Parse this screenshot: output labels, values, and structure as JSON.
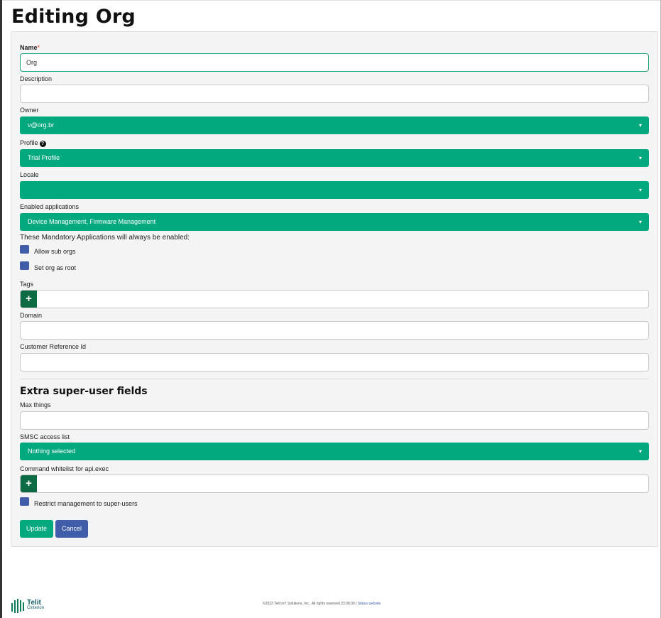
{
  "page": {
    "title": "Editing Org"
  },
  "form": {
    "name": {
      "label": "Name",
      "required_mark": "*",
      "value": "Org"
    },
    "description": {
      "label": "Description",
      "value": ""
    },
    "owner": {
      "label": "Owner",
      "value": "v@org.br"
    },
    "profile": {
      "label": "Profile",
      "value": "Trial Profile",
      "help_icon": "question-circle-icon"
    },
    "locale": {
      "label": "Locale",
      "value": ""
    },
    "enabled_applications": {
      "label": "Enabled applications",
      "value": "Device Management, Firmware Management"
    },
    "mandatory_note": "These Mandatory Applications will always be enabled:",
    "allow_sub_orgs": {
      "label": "Allow sub orgs"
    },
    "set_org_as_root": {
      "label": "Set org as root"
    },
    "tags": {
      "label": "Tags",
      "add_symbol": "+"
    },
    "domain": {
      "label": "Domain",
      "value": ""
    },
    "customer_reference_id": {
      "label": "Customer Reference Id",
      "value": ""
    }
  },
  "super_user": {
    "heading": "Extra super-user fields",
    "max_things": {
      "label": "Max things",
      "value": ""
    },
    "smsc_access_list": {
      "label": "SMSC access list",
      "value": "Nothing selected"
    },
    "command_whitelist": {
      "label": "Command whitelist for api.exec",
      "add_symbol": "+"
    },
    "restrict_management": {
      "label": "Restrict management to super-users"
    }
  },
  "actions": {
    "update_label": "Update",
    "cancel_label": "Cancel"
  },
  "footer": {
    "logo_line1": "Telit",
    "logo_line2": "Cinterion",
    "copyright": "©2023 Telit IoT Solutions, Inc.. All rights reserved.23.08.00 |",
    "status_link": "Status website"
  },
  "colors": {
    "accent": "#02a87e",
    "checkbox": "#3f5da8",
    "tag_add": "#0d6b43",
    "required": "#dd2222"
  },
  "icons": {
    "caret": "caret-down-icon",
    "add": "plus-icon",
    "help": "question-circle-icon"
  }
}
